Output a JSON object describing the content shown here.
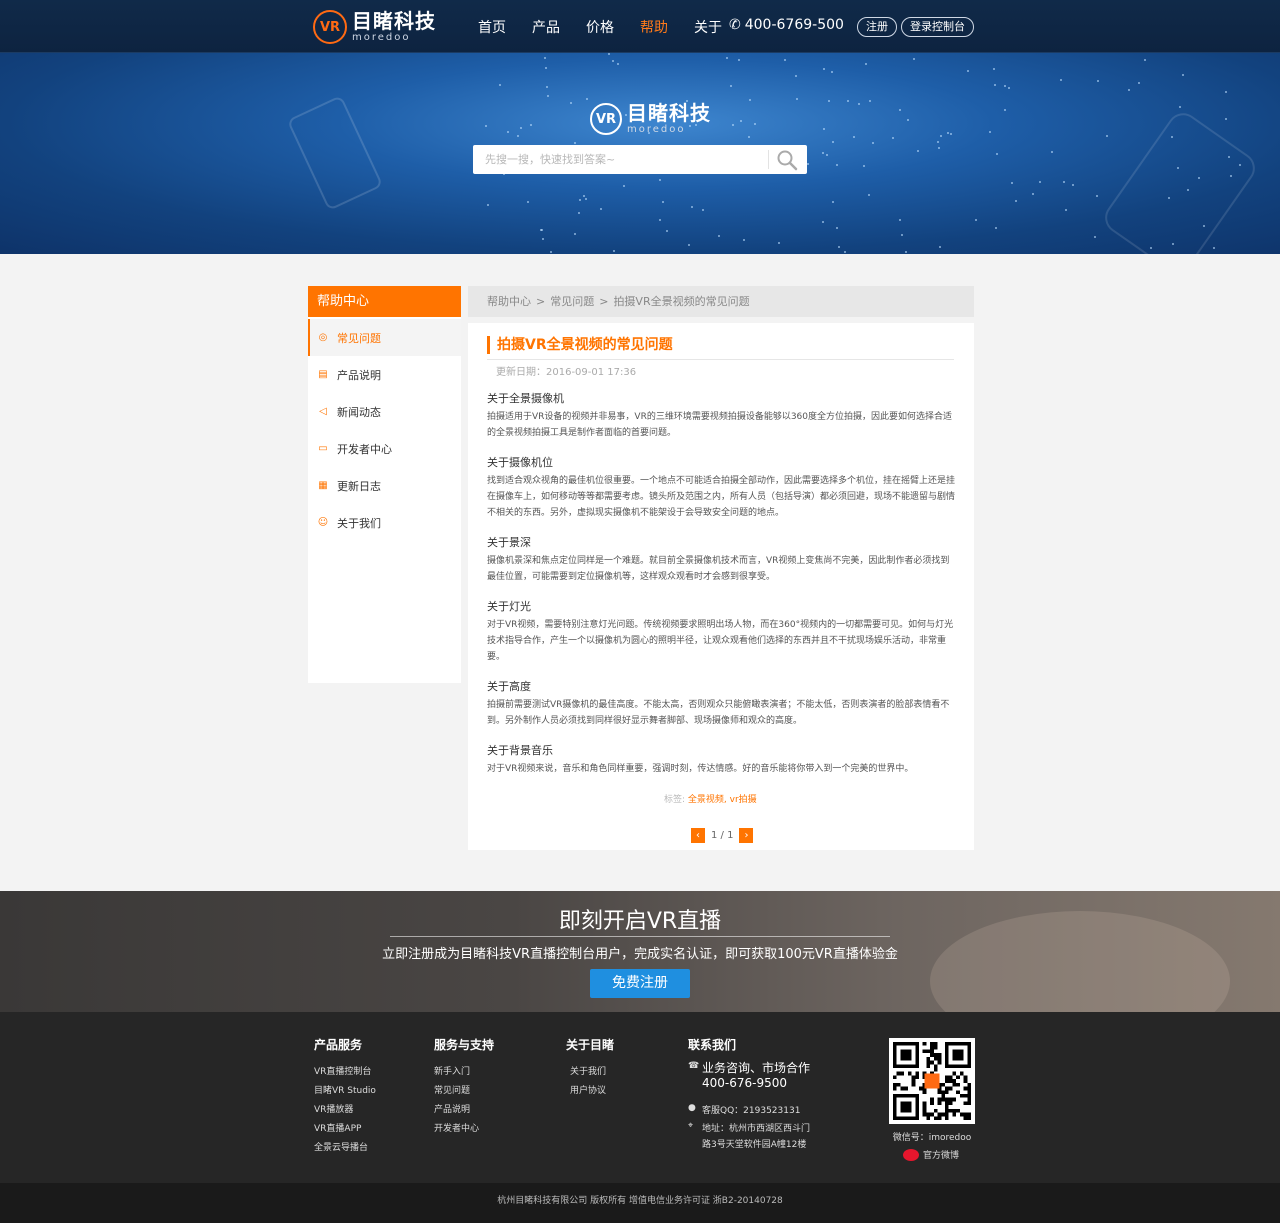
{
  "header": {
    "logo_cn": "目睹科技",
    "logo_en": "moredoo",
    "logo_mark": "VR",
    "nav": [
      "首页",
      "产品",
      "价格",
      "帮助",
      "关于"
    ],
    "active_nav": "帮助",
    "phone": "400-6769-500",
    "phone_icon": "phone-icon",
    "register_label": "注册",
    "login_label": "登录控制台"
  },
  "hero": {
    "search_placeholder": "先搜一搜，快速找到答案~",
    "search_icon": "search-icon"
  },
  "sidebar": {
    "title": "帮助中心",
    "items": [
      {
        "label": "常见问题",
        "icon": "location-icon",
        "glyph": "◎"
      },
      {
        "label": "产品说明",
        "icon": "document-icon",
        "glyph": "▤"
      },
      {
        "label": "新闻动态",
        "icon": "megaphone-icon",
        "glyph": "◁"
      },
      {
        "label": "开发者中心",
        "icon": "monitor-icon",
        "glyph": "▭"
      },
      {
        "label": "更新日志",
        "icon": "calendar-icon",
        "glyph": "▦"
      },
      {
        "label": "关于我们",
        "icon": "people-icon",
        "glyph": "☺"
      }
    ],
    "active_index": 0
  },
  "breadcrumb": [
    "帮助中心",
    "常见问题",
    "拍摄VR全景视频的常见问题"
  ],
  "breadcrumb_separator": ">",
  "article": {
    "title": "拍摄VR全景视频的常见问题",
    "date": "更新日期：2016-09-01 17:36",
    "sections": [
      {
        "heading": "关于全景摄像机",
        "body": "拍摄适用于VR设备的视频并非易事，VR的三维环境需要视频拍摄设备能够以360度全方位拍摄，因此要如何选择合适的全景视频拍摄工具是制作者面临的首要问题。"
      },
      {
        "heading": "关于摄像机位",
        "body": "找到适合观众视角的最佳机位很重要。一个地点不可能适合拍摄全部动作，因此需要选择多个机位，挂在摇臂上还是挂在摄像车上，如何移动等等都需要考虑。镜头所及范围之内，所有人员（包括导演）都必须回避，现场不能遗留与剧情不相关的东西。另外，虚拟现实摄像机不能架设于会导致安全问题的地点。"
      },
      {
        "heading": "关于景深",
        "body": "摄像机景深和焦点定位同样是一个难题。就目前全景摄像机技术而言，VR视频上变焦尚不完美，因此制作者必须找到最佳位置，可能需要到定位摄像机等，这样观众观看时才会感到很享受。"
      },
      {
        "heading": "关于灯光",
        "body": "对于VR视频，需要特别注意灯光问题。传统视频要求照明出场人物，而在360°视频内的一切都需要可见。如何与灯光技术指导合作，产生一个以摄像机为圆心的照明半径，让观众观看他们选择的东西并且不干扰现场娱乐活动，非常重要。"
      },
      {
        "heading": "关于高度",
        "body": "拍摄前需要测试VR摄像机的最佳高度。不能太高，否则观众只能俯瞰表演者；不能太低，否则表演者的脸部表情看不到。另外制作人员必须找到同样很好显示舞者脚部、现场摄像师和观众的高度。"
      },
      {
        "heading": "关于背景音乐",
        "body": "对于VR视频来说，音乐和角色同样重要，强调时刻，传达情感。好的音乐能将你带入到一个完美的世界中。"
      }
    ],
    "tags_label": "标签:",
    "tags": "全景视频, vr拍摄",
    "pager": {
      "prev": "‹",
      "text": "1 / 1",
      "next": "›"
    }
  },
  "cta": {
    "title": "即刻开启VR直播",
    "subtitle": "立即注册成为目睹科技VR直播控制台用户，完成实名认证，即可获取100元VR直播体验金",
    "button": "免费注册"
  },
  "footer": {
    "product": {
      "title": "产品服务",
      "links": [
        "VR直播控制台",
        "目睹VR Studio",
        "VR播放器",
        "VR直播APP",
        "全景云导播台"
      ]
    },
    "support": {
      "title": "服务与支持",
      "links": [
        "新手入门",
        "常见问题",
        "产品说明",
        "开发者中心"
      ]
    },
    "about": {
      "title": "关于目睹",
      "links": [
        "关于我们",
        "用户协议"
      ]
    },
    "contact": {
      "title": "联系我们",
      "business": "业务咨询、市场合作",
      "phone": "400-676-9500",
      "qq": "客服QQ：2193523131",
      "address_line1": "地址：杭州市西湖区西斗门",
      "address_line2": "路3号天堂软件园A幢12楼"
    },
    "wechat": "微信号：imoredoo",
    "weibo": "官方微博",
    "copyright": "杭州目睹科技有限公司 版权所有 增值电信业务许可证 浙B2-20140728"
  },
  "colors": {
    "accent": "#ff7400",
    "nav_bg": "#102a49",
    "cta_button": "#1f8fe0",
    "footer_bg": "#262626"
  }
}
